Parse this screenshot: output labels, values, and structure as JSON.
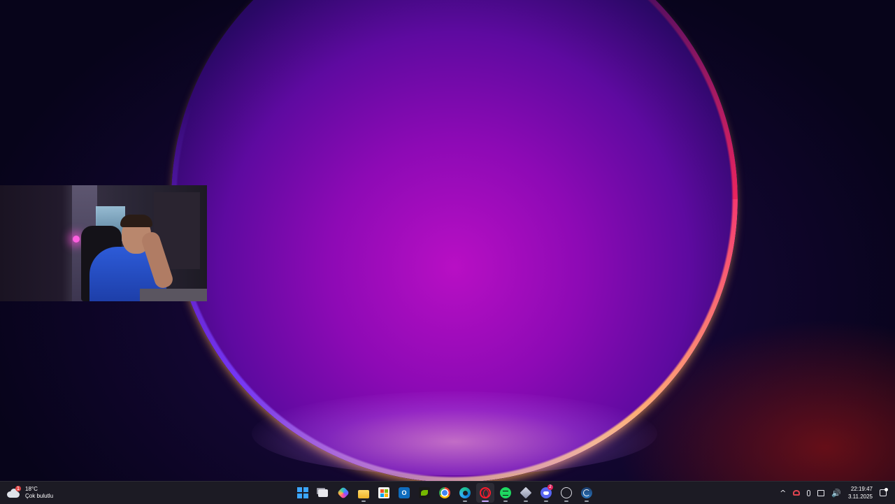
{
  "taskbar": {
    "weather": {
      "temperature": "18°C",
      "condition": "Çok bulutlu",
      "alert_count": "1",
      "icon": "cloudy-weather-icon"
    },
    "apps": [
      {
        "name": "Start",
        "icon": "windows-start-icon"
      },
      {
        "name": "Task View",
        "icon": "task-view-icon"
      },
      {
        "name": "Copilot",
        "icon": "copilot-icon"
      },
      {
        "name": "File Explorer",
        "icon": "folder-icon"
      },
      {
        "name": "Microsoft Store",
        "icon": "store-icon"
      },
      {
        "name": "Outlook",
        "icon": "outlook-icon",
        "glyph": "O"
      },
      {
        "name": "NVIDIA",
        "icon": "nvidia-icon"
      },
      {
        "name": "Google Chrome",
        "icon": "chrome-icon"
      },
      {
        "name": "Microsoft Edge",
        "icon": "edge-icon"
      },
      {
        "name": "Opera GX",
        "icon": "opera-icon"
      },
      {
        "name": "Spotify",
        "icon": "spotify-icon"
      },
      {
        "name": "Riot Client",
        "icon": "riot-icon"
      },
      {
        "name": "Discord",
        "icon": "discord-icon",
        "badge": "2"
      },
      {
        "name": "Hub",
        "icon": "hub-icon"
      },
      {
        "name": "Steam",
        "icon": "steam-icon"
      }
    ],
    "tray": {
      "chevron": "^",
      "volume_glyph": "🔊",
      "time": "22:19:47",
      "date": "3.11.2025"
    }
  },
  "colors": {
    "taskbar_bg": "#1c1b24",
    "accent_active": "#c8a8ff",
    "wallpaper_core": "#b80fc4"
  }
}
